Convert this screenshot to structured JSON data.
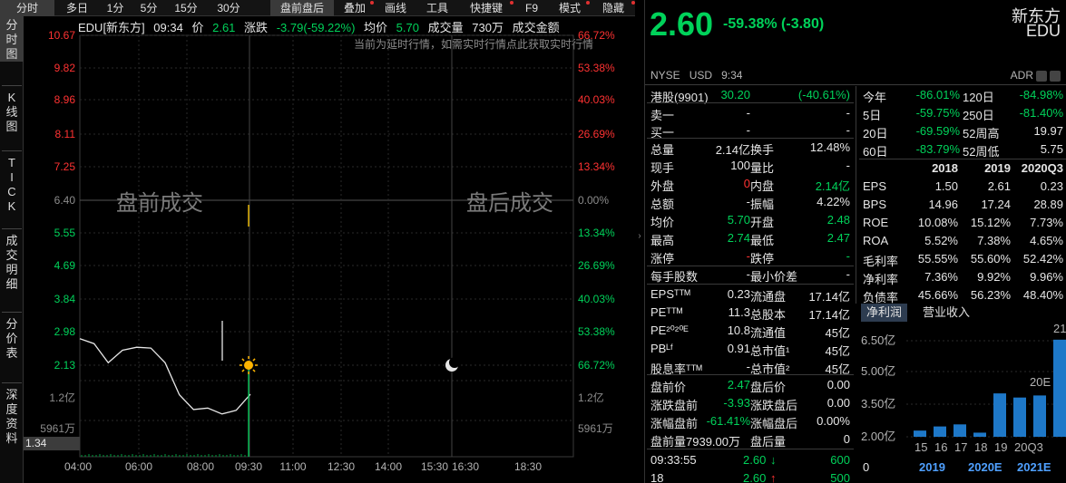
{
  "tabs": [
    "分时",
    "多日",
    "1分",
    "5分",
    "15分",
    "30分",
    "盘前盘后",
    "叠加",
    "画线",
    "工具",
    "快捷键",
    "F9",
    "模式",
    "隐藏"
  ],
  "left_buttons": [
    "分时图",
    "K线图",
    "TICK",
    "成交明细",
    "分价表",
    "深度资料"
  ],
  "info": {
    "code": "EDU[新东方]",
    "time": "09:34",
    "price_label": "价",
    "price": "2.61",
    "chg_label": "涨跌",
    "chg": "-3.79(-59.22%)",
    "avg_label": "均价",
    "avg": "5.70",
    "vol_label": "成交量",
    "vol": "730万",
    "amount_label": "成交金额"
  },
  "delay_note": "当前为延时行情，如需实时行情点此获取实时行情",
  "y_left": [
    "10.67",
    "9.82",
    "8.96",
    "8.11",
    "7.25",
    "6.40",
    "5.55",
    "4.69",
    "3.84",
    "2.98",
    "2.13"
  ],
  "y_right": [
    "66.72%",
    "53.38%",
    "40.03%",
    "26.69%",
    "13.34%",
    "0.00%",
    "13.34%",
    "26.69%",
    "40.03%",
    "53.38%",
    "66.72%"
  ],
  "vol_left": [
    "1.2亿",
    "5961万"
  ],
  "vol_right": [
    "1.2亿",
    "5961万"
  ],
  "x_labels": [
    "04:00",
    "06:00",
    "08:00",
    "09:30",
    "11:00",
    "12:30",
    "14:00",
    "15:30",
    "16:30",
    "18:30"
  ],
  "premarket_label": "盘前成交",
  "afterhours_label": "盘后成交",
  "current_price_tag": "1.34",
  "chart_data": {
    "type": "line",
    "x": [
      "04:00",
      "04:30",
      "05:00",
      "05:30",
      "06:00",
      "06:30",
      "07:00",
      "07:30",
      "08:00",
      "08:30",
      "09:00",
      "09:30",
      "09:34"
    ],
    "values": [
      3.85,
      3.7,
      3.35,
      3.55,
      3.7,
      3.6,
      3.35,
      2.55,
      2.3,
      2.25,
      2.2,
      2.2,
      2.6
    ],
    "ylim": [
      1.34,
      10.67
    ]
  },
  "header": {
    "price": "2.60",
    "change": "-59.38% (-3.80)",
    "name_cn": "新东方",
    "code": "EDU",
    "market": "NYSE",
    "currency": "USD",
    "time": "9:34",
    "adr": "ADR"
  },
  "quote_rows": [
    {
      "c1": "港股(9901)",
      "v1": "30.20",
      "v1c": "green",
      "c2": "",
      "v2": "(-40.61%)",
      "v2c": "green"
    },
    {
      "c1": "卖一",
      "v1": "-",
      "v1c": "white",
      "c2": "",
      "v2": "-",
      "v2c": "white"
    },
    {
      "c1": "买一",
      "v1": "-",
      "v1c": "white",
      "c2": "",
      "v2": "-",
      "v2c": "white"
    },
    {
      "c1": "总量",
      "v1": "2.14亿",
      "v1c": "white",
      "c2": "换手",
      "v2": "12.48%",
      "v2c": "white"
    },
    {
      "c1": "现手",
      "v1": "100",
      "v1c": "white",
      "c2": "量比",
      "v2": "-",
      "v2c": "white"
    },
    {
      "c1": "外盘",
      "v1": "0",
      "v1c": "red",
      "c2": "内盘",
      "v2": "2.14亿",
      "v2c": "green"
    },
    {
      "c1": "总额",
      "v1": "-",
      "v1c": "white",
      "c2": "振幅",
      "v2": "4.22%",
      "v2c": "white"
    },
    {
      "c1": "均价",
      "v1": "5.70",
      "v1c": "green",
      "c2": "开盘",
      "v2": "2.48",
      "v2c": "green"
    },
    {
      "c1": "最高",
      "v1": "2.74",
      "v1c": "green",
      "c2": "最低",
      "v2": "2.47",
      "v2c": "green"
    },
    {
      "c1": "涨停",
      "v1": "-",
      "v1c": "red",
      "c2": "跌停",
      "v2": "-",
      "v2c": "green"
    },
    {
      "c1": "每手股数",
      "v1": "-",
      "v1c": "white",
      "c2": "最小价差",
      "v2": "-",
      "v2c": "white"
    },
    {
      "c1": "EPSᵀᵀᴹ",
      "v1": "0.23",
      "v1c": "white",
      "c2": "流通盘",
      "v2": "17.14亿",
      "v2c": "white"
    },
    {
      "c1": "PEᵀᵀᴹ",
      "v1": "11.3",
      "v1c": "white",
      "c2": "总股本",
      "v2": "17.14亿",
      "v2c": "white"
    },
    {
      "c1": "PE²⁰²⁰ᴱ",
      "v1": "10.8",
      "v1c": "white",
      "c2": "流通值",
      "v2": "45亿",
      "v2c": "white"
    },
    {
      "c1": "PBᴸᶠ",
      "v1": "0.91",
      "v1c": "white",
      "c2": "总市值¹",
      "v2": "45亿",
      "v2c": "white"
    },
    {
      "c1": "股息率ᵀᵀᴹ",
      "v1": "-",
      "v1c": "white",
      "c2": "总市值²",
      "v2": "45亿",
      "v2c": "white"
    },
    {
      "c1": "盘前价",
      "v1": "2.47",
      "v1c": "green",
      "c2": "盘后价",
      "v2": "0.00",
      "v2c": "white"
    },
    {
      "c1": "涨跌盘前",
      "v1": "-3.93",
      "v1c": "green",
      "c2": "涨跌盘后",
      "v2": "0.00",
      "v2c": "white"
    },
    {
      "c1": "涨幅盘前",
      "v1": "-61.41%",
      "v1c": "green",
      "c2": "涨幅盘后",
      "v2": "0.00%",
      "v2c": "white"
    },
    {
      "c1": "盘前量7939.00万",
      "v1": "",
      "v1c": "white",
      "c2": "盘后量",
      "v2": "0",
      "v2c": "white"
    }
  ],
  "ticks": [
    {
      "time": "09:33:55",
      "price": "2.60",
      "arrow": "↓",
      "vol": "600"
    },
    {
      "time": "18",
      "price": "2.60",
      "arrow": "↑",
      "vol": "500"
    }
  ],
  "perf_rows": [
    {
      "a": "今年",
      "av": "-86.01%",
      "b": "120日",
      "bv": "-84.98%"
    },
    {
      "a": "5日",
      "av": "-59.75%",
      "b": "250日",
      "bv": "-81.40%"
    },
    {
      "a": "20日",
      "av": "-69.59%",
      "b": "52周高",
      "bv": "19.97"
    },
    {
      "a": "60日",
      "av": "-83.79%",
      "b": "52周低",
      "bv": "5.75"
    }
  ],
  "fin_years": [
    "2018",
    "2019",
    "2020Q3"
  ],
  "fin_rows": [
    {
      "k": "EPS",
      "v": [
        "1.50",
        "2.61",
        "0.23"
      ]
    },
    {
      "k": "BPS",
      "v": [
        "14.96",
        "17.24",
        "28.89"
      ]
    },
    {
      "k": "ROE",
      "v": [
        "10.08%",
        "15.12%",
        "7.73%"
      ]
    },
    {
      "k": "ROA",
      "v": [
        "5.52%",
        "7.38%",
        "4.65%"
      ]
    },
    {
      "k": "毛利率",
      "v": [
        "55.55%",
        "55.60%",
        "52.42%"
      ]
    },
    {
      "k": "净利率",
      "v": [
        "7.36%",
        "9.92%",
        "9.96%"
      ]
    },
    {
      "k": "负债率",
      "v": [
        "45.66%",
        "56.23%",
        "48.40%"
      ]
    }
  ],
  "fin_tabs": [
    "净利润",
    "营业收入"
  ],
  "bar_chart": {
    "y_labels": [
      "6.50亿",
      "5.00亿",
      "3.50亿",
      "2.00亿"
    ],
    "x_labels": [
      "15",
      "16",
      "17",
      "18",
      "19",
      "20Q3"
    ],
    "top_labels": [
      "21E",
      "20E"
    ],
    "bottom": [
      "0",
      "2019",
      "2020E",
      "2021E"
    ]
  },
  "chart_data_bars": {
    "type": "bar",
    "categories": [
      "15",
      "16",
      "17",
      "18",
      "19",
      "20Q3",
      "20E",
      "21E"
    ],
    "values": [
      2.3,
      2.5,
      2.6,
      2.2,
      4.1,
      3.9,
      4.0,
      6.7
    ],
    "ylim": [
      2.0,
      7.0
    ]
  }
}
